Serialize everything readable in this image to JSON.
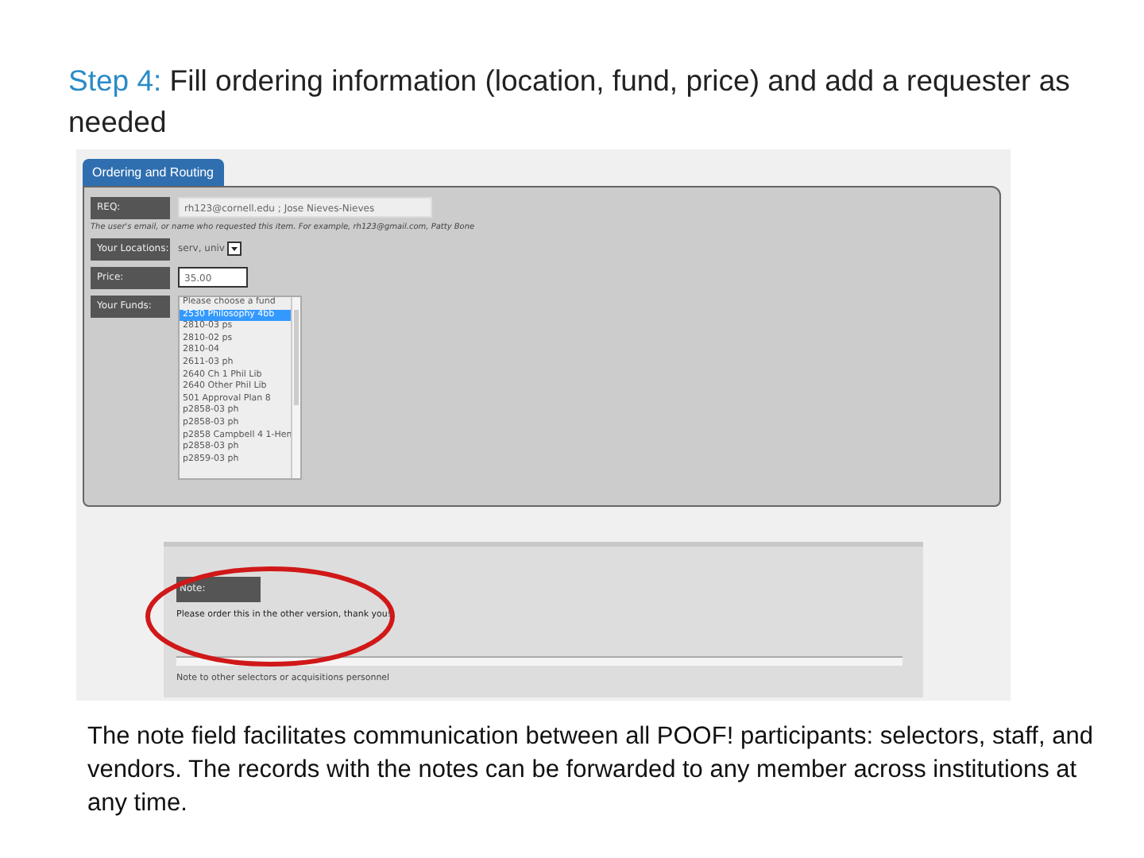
{
  "title": {
    "step": "Step 4:",
    "text": "Fill ordering information (location, fund, price) and add a requester as needed"
  },
  "screenshot": {
    "tab": {
      "label": "Ordering and Routing",
      "selected": true
    },
    "fields": [
      {
        "kind": "input",
        "label": "REQ:",
        "value": "rh123@cornell.edu ; Jose Nieves-Nieves",
        "hint": "The user's email, or name who requested this item. For example, rh123@gmail.com, Patty Bone"
      },
      {
        "kind": "select",
        "label": "Your Locations:",
        "value": "serv, univ"
      },
      {
        "kind": "input",
        "label": "Price:",
        "value": "35.00",
        "focused": true
      },
      {
        "kind": "list",
        "label": "Your Funds:",
        "options": [
          {
            "label": "Please choose a fund",
            "selected": false
          },
          {
            "label": "2530 Philosophy 4bb",
            "selected": true
          },
          {
            "label": "2810-03 ps",
            "selected": false
          },
          {
            "label": "2810-02 ps",
            "selected": false
          },
          {
            "label": "2810-04",
            "selected": false
          },
          {
            "label": "2611-03 ph",
            "selected": false
          },
          {
            "label": "2640 Ch 1 Phil Lib",
            "selected": false
          },
          {
            "label": "2640 Other Phil Lib",
            "selected": false
          },
          {
            "label": "501 Approval Plan 8",
            "selected": false
          },
          {
            "label": "p2858-03 ph",
            "selected": false
          },
          {
            "label": "p2858-03 ph",
            "selected": false
          },
          {
            "label": "p2858 Campbell 4 1-Hen",
            "selected": false
          },
          {
            "label": "p2858-03 ph",
            "selected": false
          },
          {
            "label": "p2859-03 ph",
            "selected": false
          }
        ]
      }
    ],
    "note": {
      "label": "Note:",
      "text": "Please order this in the other version, thank you!",
      "hint": "Note to other selectors or acquisitions personnel",
      "highlighted": true
    }
  },
  "caption": "The note field facilitates communication between all POOF! participants: selectors, staff, and vendors.  The records with the notes can be forwarded to any member across institutions at any time."
}
